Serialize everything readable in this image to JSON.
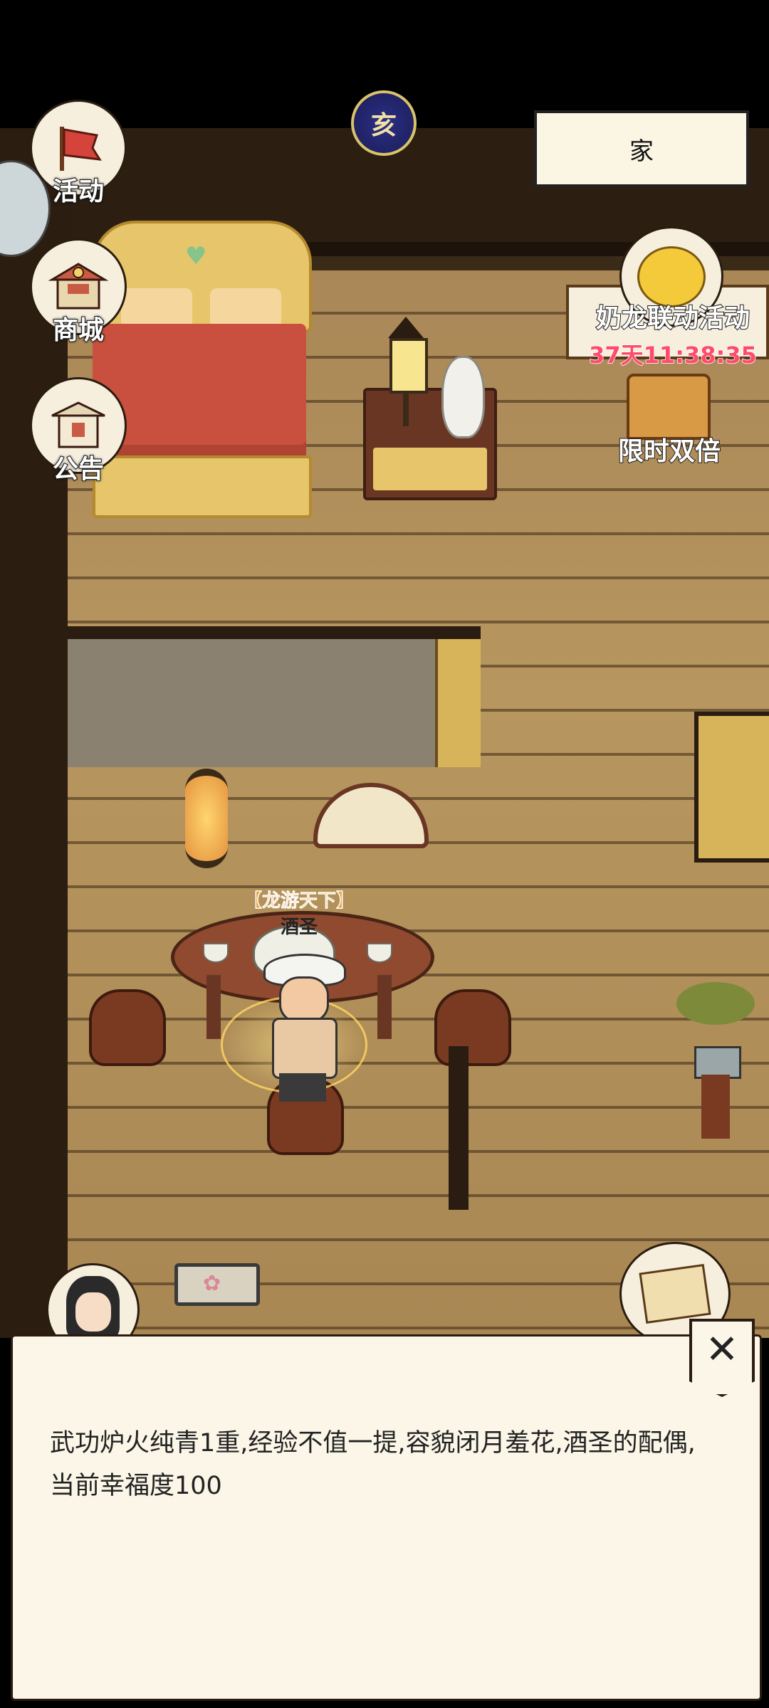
{
  "hud": {
    "activity_label": "活动",
    "shop_label": "商城",
    "notice_label": "公告",
    "time_badge": "亥",
    "location": "家"
  },
  "event": {
    "title": "奶龙联动活动",
    "timer": "37天11:38:35",
    "double_label": "限时双倍"
  },
  "player": {
    "title": "【龙游天下】",
    "name": "酒圣"
  },
  "dialog": {
    "text": "武功炉火纯青1重,经验不值一提,容貌闭月羞花,酒圣的配偶,当前幸福度100",
    "close_symbol": "✕"
  }
}
